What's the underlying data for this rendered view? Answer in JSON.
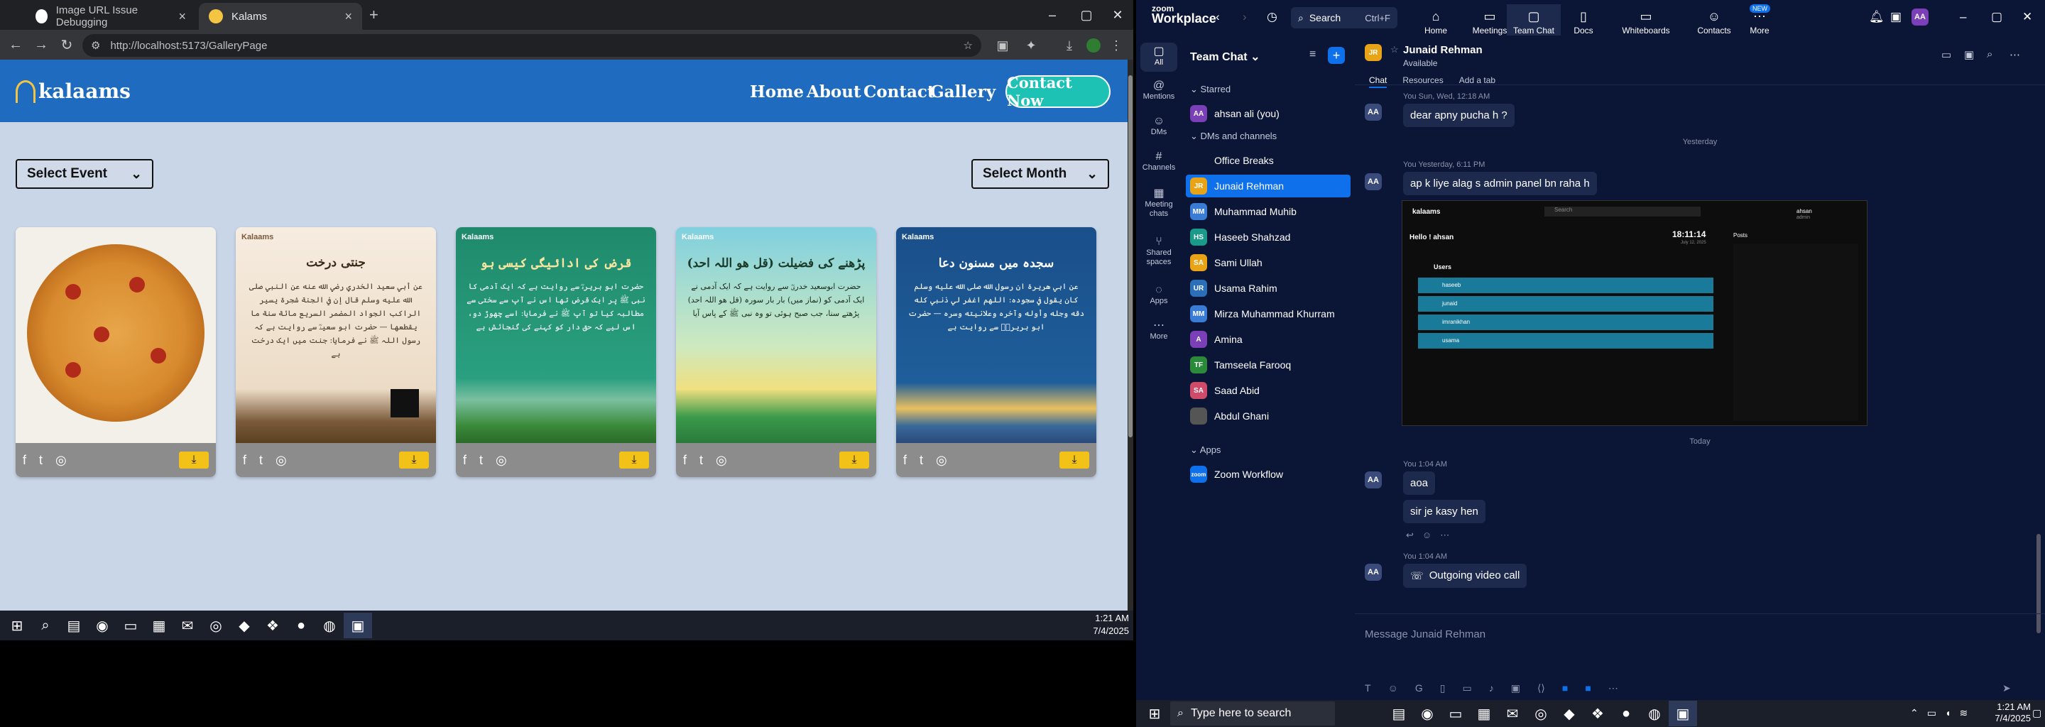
{
  "chrome": {
    "tabs": [
      {
        "title": "Image URL Issue Debugging"
      },
      {
        "title": "Kalams"
      }
    ],
    "new_tab": "+",
    "url": "http://localhost:5173/GalleryPage"
  },
  "site": {
    "logo": "kalaams",
    "nav": [
      "Home",
      "About",
      "Contact",
      "Gallery"
    ],
    "cta": "Contact Now",
    "select_event": "Select Event",
    "select_month": "Select Month",
    "cards": [
      {
        "title": "",
        "body": "",
        "bg": "#f5f0ea",
        "type": "pizza"
      },
      {
        "brand": "Kalaams",
        "title": "جنتی درخت",
        "body": "عن أبي سعيد الخدري رضي الله عنه عن النبي صلى الله عليه وسلم قال إن في الجنة شجرة يسير الراكب الجواد المضمر السريع مائة سنة ما يقطعها — حضرت ابو سعیدؓ سے روایت ہے کہ رسول اللہ ﷺ نے فرمایا: جنت میں ایک درخت ہے",
        "bg": "#f4e7d7",
        "type": "calligraphy"
      },
      {
        "brand": "Kalaams",
        "title": "قرض کی ادائیگی کیسی ہو",
        "body": "حضرت ابو ہریرہؓ سے روایت ہے کہ ایک آدمی کا نبی ﷺ پر ایک قرض تھا اس نے آپ سے سختی سے مطالبہ کیا تو آپ ﷺ نے فرمایا: اسے چھوڑ دو، اس لیے کہ حق دار کو کہنے کی گنجائش ہے",
        "bg": "#1f8a6b",
        "type": "green"
      },
      {
        "brand": "Kalaams",
        "title": "(قل ھو اللہ احد) پڑھنے کی فضیلت",
        "body": "حضرت ابوسعید خدریؓ سے روایت ہے کہ ایک آدمی نے ایک آدمی کو (نماز میں) بار بار سورہ (قل ھو اللہ احد) پڑھتے سنا، جب صبح ہوئی تو وہ نبی ﷺ کے پاس آیا",
        "bg": "#7fd0df",
        "type": "yellow"
      },
      {
        "brand": "Kalaams",
        "title": "سجدہ میں مسنون دعا",
        "body": "عن ابي هريرة ان رسول الله صلى الله عليه وسلم كان يقول في سجوده: اللهم اغفر لي ذنبي كله دقه وجله وأوله وآخره وعلانيته وسره — حضرت ابو ہریرہؓ سے روایت ہے",
        "bg": "#1a4f8a",
        "type": "blue"
      }
    ]
  },
  "left_taskbar": {
    "time": "1:21 AM",
    "date": "7/4/2025"
  },
  "zoom": {
    "logo_top": "zoom",
    "logo_bottom": "Workplace",
    "search": "Search",
    "search_shortcut": "Ctrl+F",
    "tabs": [
      "Home",
      "Meetings",
      "Team Chat",
      "Docs",
      "Whiteboards",
      "Contacts",
      "More"
    ],
    "new_badge": "NEW",
    "user_initials": "AA",
    "rail": [
      "All",
      "Mentions",
      "DMs",
      "Channels",
      "Meeting chats",
      "Shared spaces",
      "Apps",
      "More"
    ],
    "list_title": "Team Chat",
    "sections": {
      "starred": "Starred",
      "dms": "DMs and channels",
      "apps": "Apps"
    },
    "starred": [
      {
        "initials": "AA",
        "name": "ahsan ali (you)",
        "color": "#7b3fb8"
      }
    ],
    "contacts": [
      {
        "initials": "",
        "name": "Office Breaks",
        "color": "#0b1535"
      },
      {
        "initials": "JR",
        "name": "Junaid Rehman",
        "color": "#e8a317"
      },
      {
        "initials": "MM",
        "name": "Muhammad Muhib",
        "color": "#3a7bd5"
      },
      {
        "initials": "HS",
        "name": "Haseeb Shahzad",
        "color": "#1a9b8a"
      },
      {
        "initials": "SA",
        "name": "Sami Ullah",
        "color": "#e8a317"
      },
      {
        "initials": "UR",
        "name": "Usama Rahim",
        "color": "#2a6fb8"
      },
      {
        "initials": "MM",
        "name": "Mirza Muhammad Khurram",
        "color": "#3a7bd5"
      },
      {
        "initials": "A",
        "name": "Amina",
        "color": "#7b3fb8"
      },
      {
        "initials": "TF",
        "name": "Tamseela Farooq",
        "color": "#2a8a3a"
      },
      {
        "initials": "SA",
        "name": "Saad Abid",
        "color": "#d04a6a"
      },
      {
        "initials": "",
        "name": "Abdul Ghani",
        "color": "#555"
      }
    ],
    "apps": [
      {
        "initials": "zoom",
        "name": "Zoom Workflow",
        "color": "#0e71eb"
      }
    ],
    "chat": {
      "name": "Junaid Rehman",
      "status": "Available",
      "initials": "JR",
      "tabs": [
        "Chat",
        "Resources",
        "Add a tab"
      ],
      "messages": [
        {
          "meta": "You  Sun, Wed, 12:18 AM",
          "text": "dear apny pucha h ?"
        },
        {
          "sep": "Yesterday"
        },
        {
          "meta": "You  Yesterday, 6:11 PM",
          "text": "ap k liye alag s admin panel bn raha h"
        },
        {
          "sep": "Today"
        },
        {
          "meta": "You  1:04 AM",
          "text": "aoa",
          "text2": "sir je kasy hen"
        },
        {
          "meta": "You  1:04 AM",
          "text": "Outgoing video call"
        }
      ],
      "preview": {
        "logo": "kalaams",
        "search": "Search",
        "greeting": "Hello ! ahsan",
        "clock": "18:11:14",
        "date": "July 12, 2025",
        "users_title": "Users",
        "posts_title": "Posts",
        "user_label": "ahsan",
        "user_role": "admin",
        "users": [
          "haseeb",
          "junaid",
          "imranikhan",
          "usama"
        ]
      },
      "placeholder": "Message Junaid Rehman"
    }
  },
  "right_taskbar": {
    "search": "Type here to search",
    "time": "1:21 AM",
    "date": "7/4/2025"
  }
}
